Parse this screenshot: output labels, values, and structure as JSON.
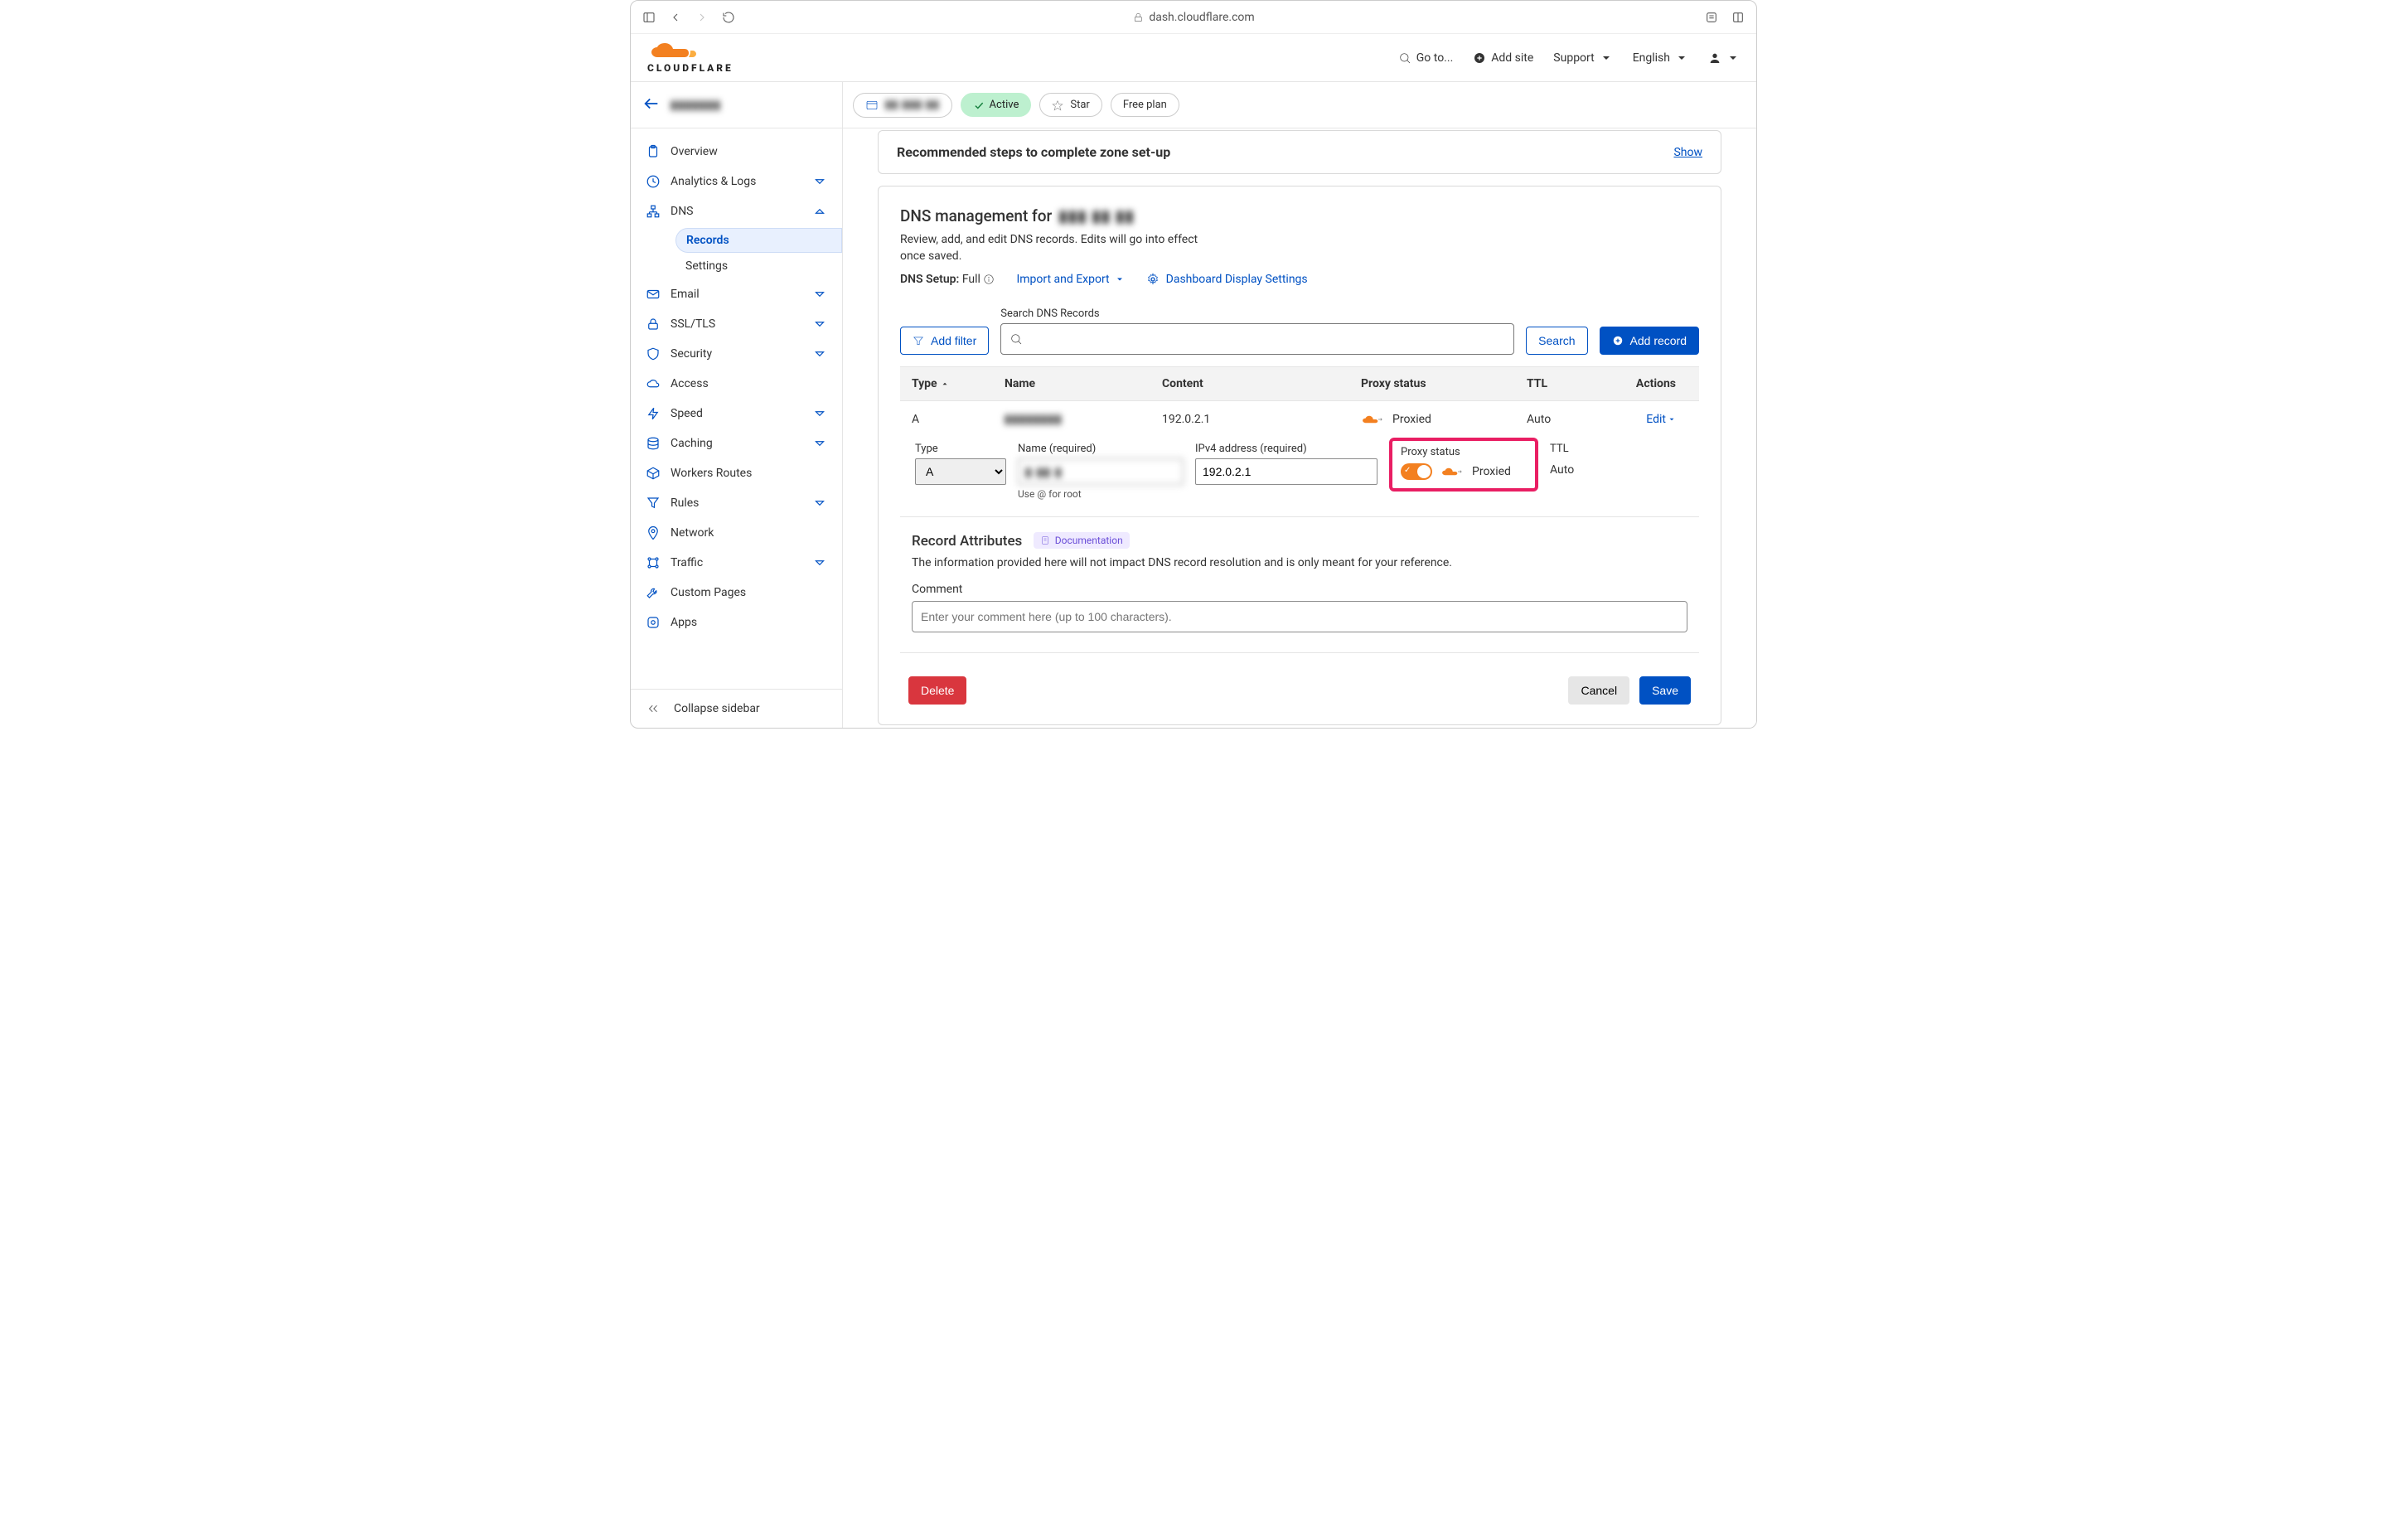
{
  "browser": {
    "url": "dash.cloudflare.com"
  },
  "header": {
    "goto": "Go to...",
    "add_site": "Add site",
    "support": "Support",
    "language": "English"
  },
  "sidebar": {
    "site_blur": "▮▮▮▮▮▮▮",
    "items": [
      {
        "label": "Overview",
        "icon": "clipboard"
      },
      {
        "label": "Analytics & Logs",
        "icon": "clock",
        "expandable": true
      },
      {
        "label": "DNS",
        "icon": "sitemap",
        "expandable": true,
        "open": true
      },
      {
        "label": "Email",
        "icon": "mail",
        "expandable": true
      },
      {
        "label": "SSL/TLS",
        "icon": "lock",
        "expandable": true
      },
      {
        "label": "Security",
        "icon": "shield",
        "expandable": true
      },
      {
        "label": "Access",
        "icon": "cloud"
      },
      {
        "label": "Speed",
        "icon": "bolt",
        "expandable": true
      },
      {
        "label": "Caching",
        "icon": "layers",
        "expandable": true
      },
      {
        "label": "Workers Routes",
        "icon": "workers"
      },
      {
        "label": "Rules",
        "icon": "funnel",
        "expandable": true
      },
      {
        "label": "Network",
        "icon": "pin"
      },
      {
        "label": "Traffic",
        "icon": "graph",
        "expandable": true
      },
      {
        "label": "Custom Pages",
        "icon": "wrench"
      },
      {
        "label": "Apps",
        "icon": "app"
      }
    ],
    "dns_sub": {
      "records": "Records",
      "settings": "Settings"
    },
    "collapse": "Collapse sidebar"
  },
  "toolbar": {
    "site_blur": "▮▮ ▮▮▮ ▮▮",
    "active": "Active",
    "star": "Star",
    "plan": "Free plan"
  },
  "rec_banner": {
    "title": "Recommended steps to complete zone set-up",
    "action": "Show"
  },
  "mgmt": {
    "title_prefix": "DNS management for",
    "title_blur": "▮▮▮ ▮▮ ▮▮",
    "desc": "Review, add, and edit DNS records. Edits will go into effect once saved.",
    "setup_label": "DNS Setup:",
    "setup_value": "Full",
    "import_export": "Import and Export",
    "display_settings": "Dashboard Display Settings"
  },
  "search": {
    "add_filter": "Add filter",
    "label": "Search DNS Records",
    "search_btn": "Search",
    "add_record": "Add record"
  },
  "columns": {
    "type": "Type",
    "name": "Name",
    "content": "Content",
    "proxy": "Proxy status",
    "ttl": "TTL",
    "actions": "Actions"
  },
  "row": {
    "type": "A",
    "name_blur": "▮▮▮▮▮▮▮▮",
    "content": "192.0.2.1",
    "proxy": "Proxied",
    "ttl": "Auto",
    "edit": "Edit"
  },
  "form": {
    "type_label": "Type",
    "type_value": "A",
    "name_label": "Name (required)",
    "name_value_blur": "▮ ▮▮ ▮",
    "name_help": "Use @ for root",
    "ip_label": "IPv4 address (required)",
    "ip_value": "192.0.2.1",
    "proxy_label": "Proxy status",
    "proxy_value": "Proxied",
    "ttl_label": "TTL",
    "ttl_value": "Auto"
  },
  "attrs": {
    "title": "Record Attributes",
    "doc": "Documentation",
    "desc": "The information provided here will not impact DNS record resolution and is only meant for your reference.",
    "comment_label": "Comment",
    "comment_placeholder": "Enter your comment here (up to 100 characters)."
  },
  "footer": {
    "delete": "Delete",
    "cancel": "Cancel",
    "save": "Save"
  }
}
